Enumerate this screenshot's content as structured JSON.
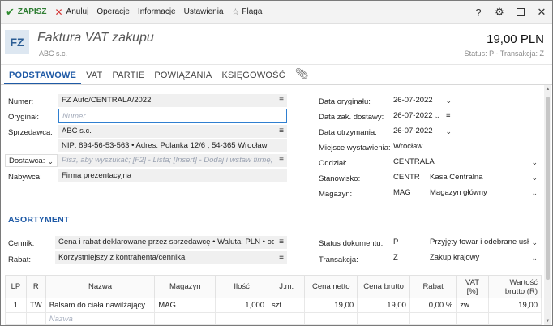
{
  "toolbar": {
    "save_label": "ZAPISZ",
    "cancel_label": "Anuluj",
    "operations_label": "Operacje",
    "info_label": "Informacje",
    "settings_label": "Ustawienia",
    "flag_label": "Flaga",
    "help_glyph": "?"
  },
  "header": {
    "badge": "FZ",
    "title": "Faktura VAT zakupu",
    "subtitle": "ABC s.c.",
    "amount": "19,00 PLN",
    "status": "Status:  P  -  Transakcja:  Z"
  },
  "tabs": [
    {
      "label": "PODSTAWOWE",
      "active": true
    },
    {
      "label": "VAT"
    },
    {
      "label": "PARTIE"
    },
    {
      "label": "POWIĄZANIA"
    },
    {
      "label": "KSIĘGOWOŚĆ"
    }
  ],
  "left": {
    "number_label": "Numer:",
    "number_value": "FZ Auto/CENTRALA/2022",
    "original_label": "Oryginał:",
    "original_placeholder": "Numer",
    "seller_label": "Sprzedawca:",
    "seller_value": "ABC s.c.",
    "seller_details": "NIP:  894-56-53-563  •  Adres:  Polanka  12/6 , 54-365 Wrocław",
    "supplier_label": "Dostawca:",
    "supplier_placeholder": "Pisz, aby wyszukać; [F2] - Lista; [Insert] - Dodaj i wstaw firmę;",
    "buyer_label": "Nabywca:",
    "buyer_value": "Firma prezentacyjna"
  },
  "right": {
    "orig_date_label": "Data oryginału:",
    "orig_date": "26-07-2022",
    "delivery_date_label": "Data zak. dostawy:",
    "delivery_date": "26-07-2022",
    "receipt_date_label": "Data otrzymania:",
    "receipt_date": "26-07-2022",
    "place_label": "Miejsce wystawienia:",
    "place_value": "Wrocław",
    "branch_label": "Oddział:",
    "branch_value": "CENTRALA",
    "station_label": "Stanowisko:",
    "station_code": "CENTR",
    "station_name": "Kasa Centralna",
    "warehouse_label": "Magazyn:",
    "warehouse_code": "MAG",
    "warehouse_name": "Magazyn główny"
  },
  "assortment": {
    "title": "ASORTYMENT",
    "pricelist_label": "Cennik:",
    "pricelist_value": "Cena i rabat deklarowane przez sprzedawcę • Waluta: PLN • od ne",
    "discount_label": "Rabat:",
    "discount_value": "Korzystniejszy z kontrahenta/cennika",
    "doc_status_label": "Status dokumentu:",
    "doc_status_code": "P",
    "doc_status_name": "Przyjęty towar i odebrane usłu",
    "transaction_label": "Transakcja:",
    "transaction_code": "Z",
    "transaction_name": "Zakup krajowy"
  },
  "table": {
    "headers": [
      "LP",
      "R",
      "Nazwa",
      "Magazyn",
      "Ilość",
      "J.m.",
      "Cena netto",
      "Cena brutto",
      "Rabat",
      "VAT [%]",
      "Wartość brutto (R)"
    ],
    "rows": [
      [
        "1",
        "TW",
        "Balsam do ciała nawilżający...",
        "MAG",
        "1,000",
        "szt",
        "19,00",
        "19,00",
        "0,00 %",
        "zw",
        "19,00"
      ]
    ],
    "new_row_placeholder": "Nazwa"
  }
}
